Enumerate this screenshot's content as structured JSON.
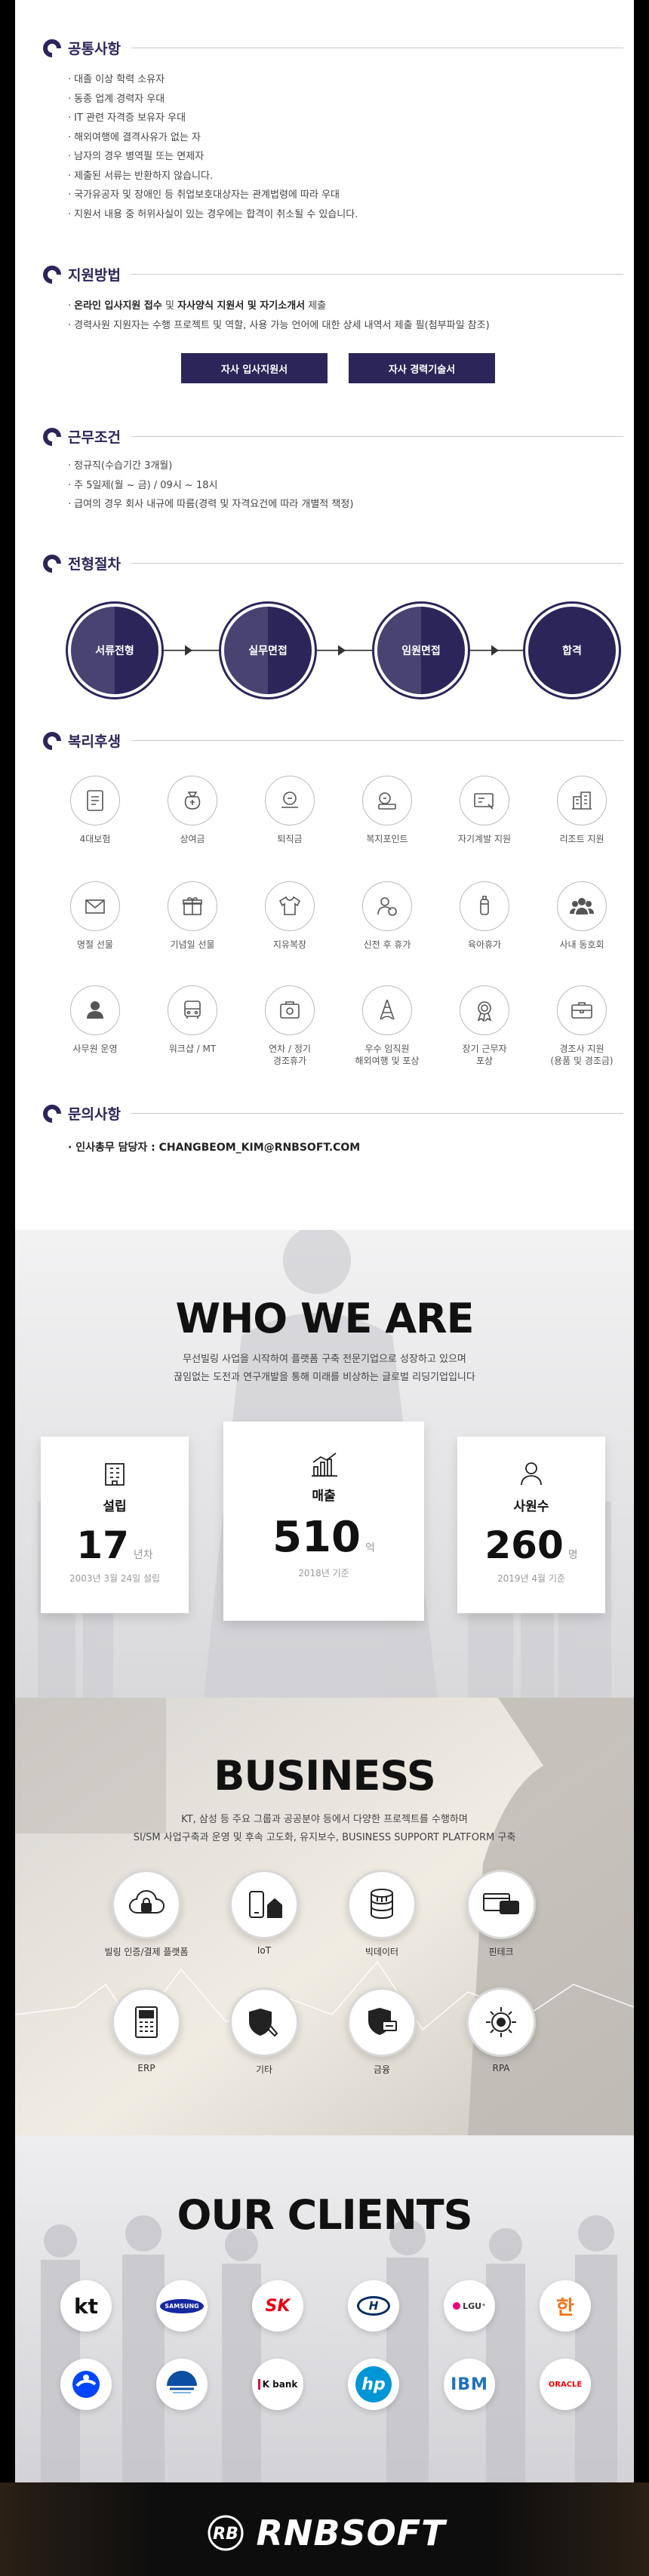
{
  "notice": {
    "title": "공통사항",
    "items": [
      "대졸 이상 학력 소유자",
      "동종 업계 경력자 우대",
      "IT 관련 자격증 보유자 우대",
      "해외여행에 결격사유가 없는 자",
      "남자의 경우 병역필 또는 면제자",
      "제출된 서류는 반환하지 않습니다.",
      "국가유공자 및 장애인 등 취업보호대상자는 관계법령에 따라 우대",
      "지원서 내용 중 허위사실이 있는 경우에는 합격이 취소될 수 있습니다."
    ]
  },
  "apply": {
    "title": "지원방법",
    "line1_b1": "온라인 입사지원 접수",
    "line1_mid": " 및 ",
    "line1_b2": "자사양식 지원서 및 자기소개서",
    "line1_end": " 제출",
    "line2": "경력사원 지원자는 수행 프로젝트 및 역할, 사용 가능 언어에 대한 상세 내역서 제출 필(첨부파일 참조)",
    "btn_form": "자사 입사지원서",
    "btn_career": "자사 경력기술서"
  },
  "conditions": {
    "title": "근무조건",
    "items": [
      "정규직(수습기간 3개월)",
      "주 5일제(월 ~ 금) / 09시 ~ 18시",
      "급여의 경우 회사 내규에 따름(경력 및 자격요건에 따라 개별적 책정)"
    ]
  },
  "process": {
    "title": "전형절차",
    "steps": [
      "서류전형",
      "실무면접",
      "임원면접",
      "합격"
    ]
  },
  "benefits": {
    "title": "복리후생",
    "items": [
      {
        "label": "4대보험",
        "icon": "insurance-card-icon"
      },
      {
        "label": "상여금",
        "icon": "money-bag-icon"
      },
      {
        "label": "퇴직금",
        "icon": "severance-pay-icon"
      },
      {
        "label": "복지포인트",
        "icon": "welfare-points-icon"
      },
      {
        "label": "자기계발 지원",
        "icon": "self-development-icon"
      },
      {
        "label": "리조트 지원",
        "icon": "resort-building-icon"
      },
      {
        "label": "명절 선물",
        "icon": "holiday-gift-envelope-icon"
      },
      {
        "label": "기념일 선물",
        "icon": "gift-box-icon"
      },
      {
        "label": "지유복장",
        "icon": "casual-shirt-icon"
      },
      {
        "label": "신전 후 휴가",
        "icon": "vacation-person-icon"
      },
      {
        "label": "육아휴가",
        "icon": "baby-bottle-icon"
      },
      {
        "label": "사내 동호회",
        "icon": "club-people-icon"
      },
      {
        "label": "사무원 운영",
        "icon": "staff-person-icon"
      },
      {
        "label": "워크샵 / MT",
        "icon": "bus-icon"
      },
      {
        "label": "연차 / 정기\n경조휴가",
        "icon": "calendar-leave-icon"
      },
      {
        "label": "우수 임직원\n해외여행 및 포상",
        "icon": "eiffel-tower-icon"
      },
      {
        "label": "장기 근무자\n포상",
        "icon": "award-medal-icon"
      },
      {
        "label": "경조사 지원\n(용품 및 경조금)",
        "icon": "briefcase-icon"
      }
    ]
  },
  "contact": {
    "title": "문의사항",
    "text": "인사총무 담당자 : CHANGBEOM_KIM@RNBSOFT.COM"
  },
  "who": {
    "title": "WHO WE ARE",
    "sub1": "무선빌링 사업을 시작하여 플랫폼 구축 전문기업으로 성장하고 있으며",
    "sub2": "끊임없는 도전과 연구개발을 통해 미래를 비상하는 글로벌 리딩기업입니다",
    "stats": [
      {
        "label": "설립",
        "value": "17",
        "unit": "년차",
        "note": "2003년 3월 24일 설립",
        "icon": "building-icon"
      },
      {
        "label": "매출",
        "value": "510",
        "unit": "억",
        "note": "2018년 기준",
        "icon": "bar-chart-icon"
      },
      {
        "label": "사원수",
        "value": "260",
        "unit": "명",
        "note": "2019년 4월 기준",
        "icon": "person-icon"
      }
    ]
  },
  "business": {
    "title": "BUSINESS",
    "sub1": "KT, 삼성 등 주요 그룹과 공공분야 등에서 다양한 프로젝트를 수행하며",
    "sub2": "SI/SM 사업구축과 운영 및 후속 고도화, 유지보수, BUSINESS SUPPORT PLATFORM 구축",
    "items": [
      {
        "label": "빌링 인증/결제 플랫폼",
        "icon": "cloud-lock-icon"
      },
      {
        "label": "IoT",
        "icon": "iot-home-icon"
      },
      {
        "label": "빅데이터",
        "icon": "database-icon"
      },
      {
        "label": "핀테크",
        "icon": "fintech-card-icon"
      },
      {
        "label": "ERP",
        "icon": "erp-server-icon"
      },
      {
        "label": "기타",
        "icon": "shield-tools-icon"
      },
      {
        "label": "금융",
        "icon": "finance-shield-icon"
      },
      {
        "label": "RPA",
        "icon": "rpa-gear-icon"
      }
    ]
  },
  "clients": {
    "title": "OUR CLIENTS",
    "row1": [
      "kt",
      "SAMSUNG",
      "SK",
      "H",
      "LGU⁺",
      "한"
    ],
    "row2": [
      "",
      "",
      "K bank",
      "hp",
      "IBM",
      "ORACLE"
    ]
  },
  "footer": {
    "brand": "RNBSOFT",
    "mark": "RB"
  },
  "colors": {
    "primary": "#2b2559",
    "divider": "#c9c9d4"
  }
}
